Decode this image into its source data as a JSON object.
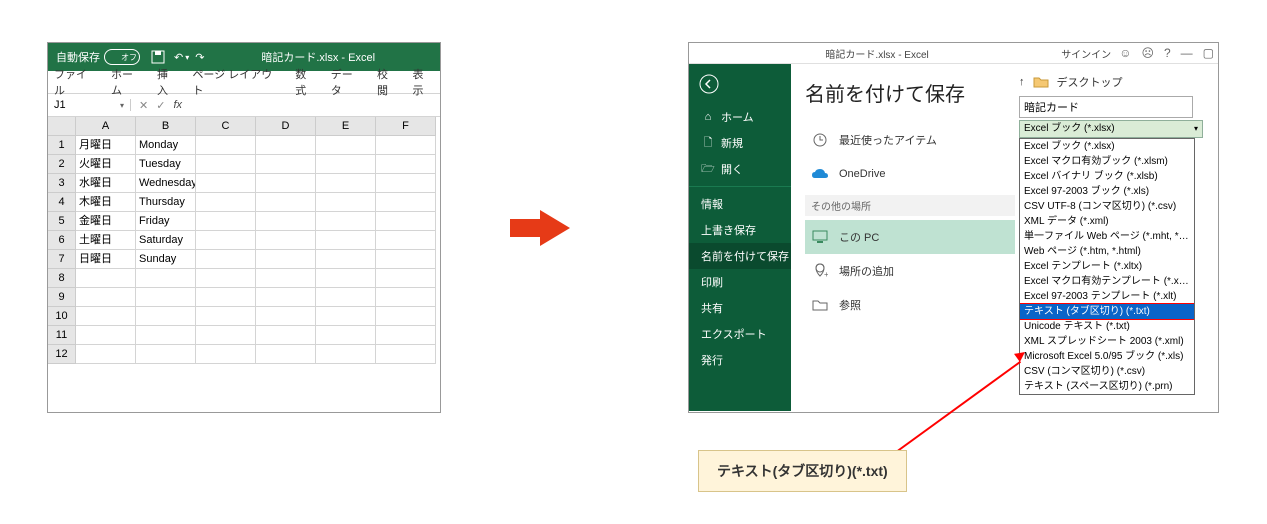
{
  "left": {
    "autosave_label": "自動保存",
    "autosave_state": "オフ",
    "title": "暗記カード.xlsx - Excel",
    "tabs": [
      "ファイル",
      "ホーム",
      "挿入",
      "ページ レイアウト",
      "数式",
      "データ",
      "校閲",
      "表示"
    ],
    "namebox": "J1",
    "columns": [
      "A",
      "B",
      "C",
      "D",
      "E",
      "F"
    ],
    "rows": [
      {
        "n": "1",
        "a": "月曜日",
        "b": "Monday"
      },
      {
        "n": "2",
        "a": "火曜日",
        "b": "Tuesday"
      },
      {
        "n": "3",
        "a": "水曜日",
        "b": "Wednesday"
      },
      {
        "n": "4",
        "a": "木曜日",
        "b": "Thursday"
      },
      {
        "n": "5",
        "a": "金曜日",
        "b": "Friday"
      },
      {
        "n": "6",
        "a": "土曜日",
        "b": "Saturday"
      },
      {
        "n": "7",
        "a": "日曜日",
        "b": "Sunday"
      },
      {
        "n": "8",
        "a": "",
        "b": ""
      },
      {
        "n": "9",
        "a": "",
        "b": ""
      },
      {
        "n": "10",
        "a": "",
        "b": ""
      },
      {
        "n": "11",
        "a": "",
        "b": ""
      },
      {
        "n": "12",
        "a": "",
        "b": ""
      }
    ]
  },
  "right": {
    "titlebar": "暗記カード.xlsx - Excel",
    "signin": "サインイン",
    "sidebar": {
      "home": "ホーム",
      "new": "新規",
      "open": "開く",
      "info": "情報",
      "save": "上書き保存",
      "saveas": "名前を付けて保存",
      "print": "印刷",
      "share": "共有",
      "export": "エクスポート",
      "publish": "発行"
    },
    "heading": "名前を付けて保存",
    "locations": {
      "recent": "最近使ったアイテム",
      "onedrive": "OneDrive",
      "other_section": "その他の場所",
      "thispc": "この PC",
      "addplace": "場所の追加",
      "browse": "参照"
    },
    "up_arrow": "↑",
    "desktop": "デスクトップ",
    "filename": "暗記カード",
    "selected_type": "Excel ブック (*.xlsx)",
    "filetypes": [
      "Excel ブック (*.xlsx)",
      "Excel マクロ有効ブック (*.xlsm)",
      "Excel バイナリ ブック (*.xlsb)",
      "Excel 97-2003 ブック (*.xls)",
      "CSV UTF-8 (コンマ区切り) (*.csv)",
      "XML データ (*.xml)",
      "単一ファイル Web ページ (*.mht, *.mhtml)",
      "Web ページ (*.htm, *.html)",
      "Excel テンプレート (*.xltx)",
      "Excel マクロ有効テンプレート (*.xltm)",
      "Excel 97-2003 テンプレート (*.xlt)",
      "テキスト (タブ区切り) (*.txt)",
      "Unicode テキスト (*.txt)",
      "XML スプレッドシート 2003 (*.xml)",
      "Microsoft Excel 5.0/95 ブック (*.xls)",
      "CSV (コンマ区切り) (*.csv)",
      "テキスト (スペース区切り) (*.prn)"
    ],
    "highlight_index": 11
  },
  "callout": "テキスト(タブ区切り)(*.txt)"
}
